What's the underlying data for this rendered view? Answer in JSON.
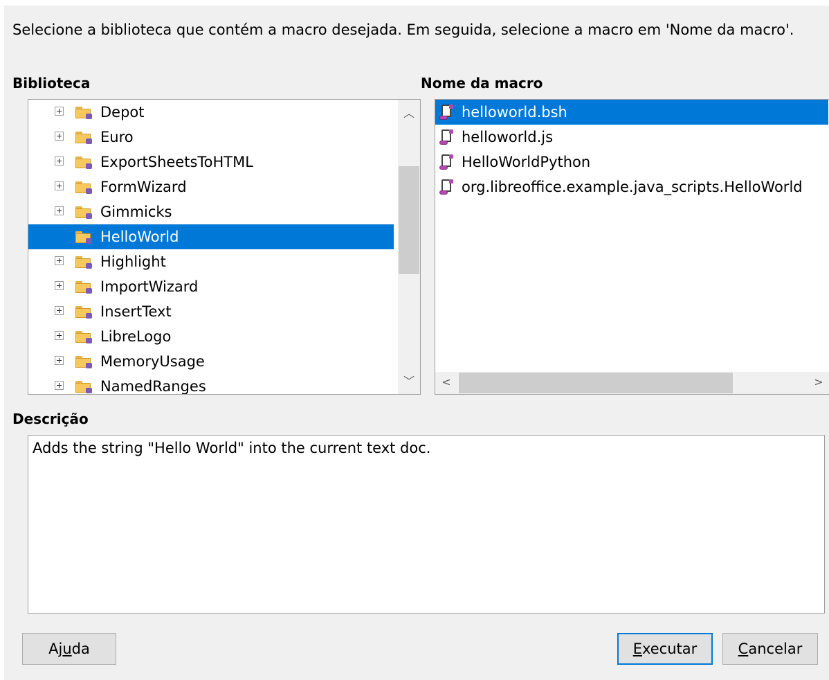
{
  "instruction": "Selecione a biblioteca que contém a macro desejada. Em seguida, selecione a macro em 'Nome da macro'.",
  "library": {
    "label": "Biblioteca",
    "items": [
      {
        "label": "Depot",
        "expandable": true,
        "selected": false
      },
      {
        "label": "Euro",
        "expandable": true,
        "selected": false
      },
      {
        "label": "ExportSheetsToHTML",
        "expandable": true,
        "selected": false
      },
      {
        "label": "FormWizard",
        "expandable": true,
        "selected": false
      },
      {
        "label": "Gimmicks",
        "expandable": true,
        "selected": false
      },
      {
        "label": "HelloWorld",
        "expandable": false,
        "selected": true
      },
      {
        "label": "Highlight",
        "expandable": true,
        "selected": false
      },
      {
        "label": "ImportWizard",
        "expandable": true,
        "selected": false
      },
      {
        "label": "InsertText",
        "expandable": true,
        "selected": false
      },
      {
        "label": "LibreLogo",
        "expandable": true,
        "selected": false
      },
      {
        "label": "MemoryUsage",
        "expandable": true,
        "selected": false
      },
      {
        "label": "NamedRanges",
        "expandable": true,
        "selected": false
      }
    ]
  },
  "macro_name": {
    "label": "Nome da macro",
    "items": [
      {
        "label": "helloworld.bsh",
        "selected": true
      },
      {
        "label": "helloworld.js",
        "selected": false
      },
      {
        "label": "HelloWorldPython",
        "selected": false
      },
      {
        "label": "org.libreoffice.example.java_scripts.HelloWorld",
        "selected": false
      }
    ]
  },
  "description": {
    "label": "Descrição",
    "text": "Adds the string \"Hello World\" into the current text doc."
  },
  "buttons": {
    "help": {
      "pre": "Aj",
      "accel": "u",
      "post": "da"
    },
    "run": {
      "pre": "",
      "accel": "E",
      "post": "xecutar"
    },
    "cancel": {
      "pre": "",
      "accel": "C",
      "post": "ancelar"
    }
  },
  "colors": {
    "selection": "#0078d7",
    "dialog_bg": "#f0f0f0",
    "folder": "#f6c95f",
    "script_accent": "#b24ab0"
  },
  "icons": {
    "expander": "plus-box-icon",
    "library": "macro-folder-icon",
    "macro": "script-scroll-icon",
    "scroll_up": "chevron-up-icon",
    "scroll_down": "chevron-down-icon",
    "scroll_left": "chevron-left-icon",
    "scroll_right": "chevron-right-icon"
  }
}
